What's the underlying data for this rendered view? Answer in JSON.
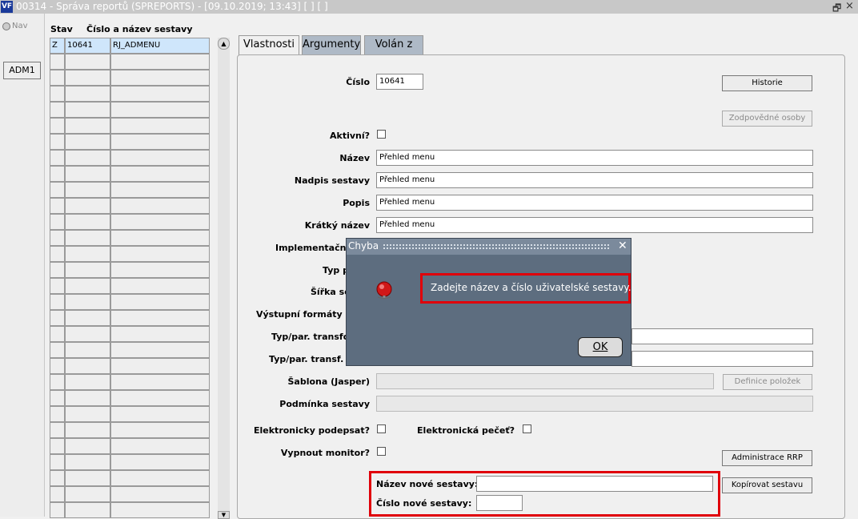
{
  "window": {
    "logo": "VF",
    "title": "00314 - Správa reportů (SPREPORTS) - [09.10.2019; 13:43]  [ ]  [ ]",
    "restore_symbol": "🗗",
    "close_symbol": "×"
  },
  "left": {
    "nav_label": "Nav",
    "adm_button": "ADM1"
  },
  "grid": {
    "col_status": "Stav",
    "col_number_name": "Číslo a název sestavy",
    "rows": [
      {
        "status": "Z",
        "number": "10641",
        "name": "RJ_ADMENU"
      }
    ]
  },
  "tabs": [
    {
      "label": "Vlastnosti"
    },
    {
      "label": "Argumenty"
    },
    {
      "label": "Volán z"
    }
  ],
  "form": {
    "cislo_label": "Číslo",
    "cislo_value": "10641",
    "historie_button": "Historie",
    "zodpovedne_button": "Zodpovědné osoby",
    "aktivni_label": "Aktivní?",
    "nazev_label": "Název",
    "nazev_value": "Přehled menu",
    "nadpis_label": "Nadpis sestavy",
    "nadpis_value": "Přehled menu",
    "popis_label": "Popis",
    "popis_value": "Přehled menu",
    "kratky_label": "Krátký název",
    "kratky_value": "Přehled menu",
    "implementacni_label": "Implementační",
    "typ_label": "Typ p",
    "sirka_label": "Šířka se",
    "vystupni_label": "Výstupní formáty se",
    "typpar_label": "Typ/par. transfor",
    "typpar2_label": "Typ/par. transf. (i",
    "sablona_label": "Šablona (Jasper)",
    "definice_button": "Definice položek",
    "podminka_label": "Podmínka sestavy",
    "el_podepsat_label": "Elektronicky podepsat?",
    "el_pecet_label": "Elektronická pečeť?",
    "vypnout_label": "Vypnout monitor?",
    "administrace_button": "Administrace RRP",
    "nazev_nove_label": "Název nové sestavy:",
    "cislo_nove_label": "Číslo nové sestavy:",
    "kopirovat_button": "Kopírovat sestavu"
  },
  "dialog": {
    "title": "Chyba",
    "close": "✕",
    "message": "Zadejte název a číslo uživatelské sestavy.",
    "ok_button": "OK"
  },
  "colors": {
    "highlight_red": "#e0000a",
    "selected_row": "#cfe6fb",
    "dialog_bg": "#5d6d7f"
  }
}
